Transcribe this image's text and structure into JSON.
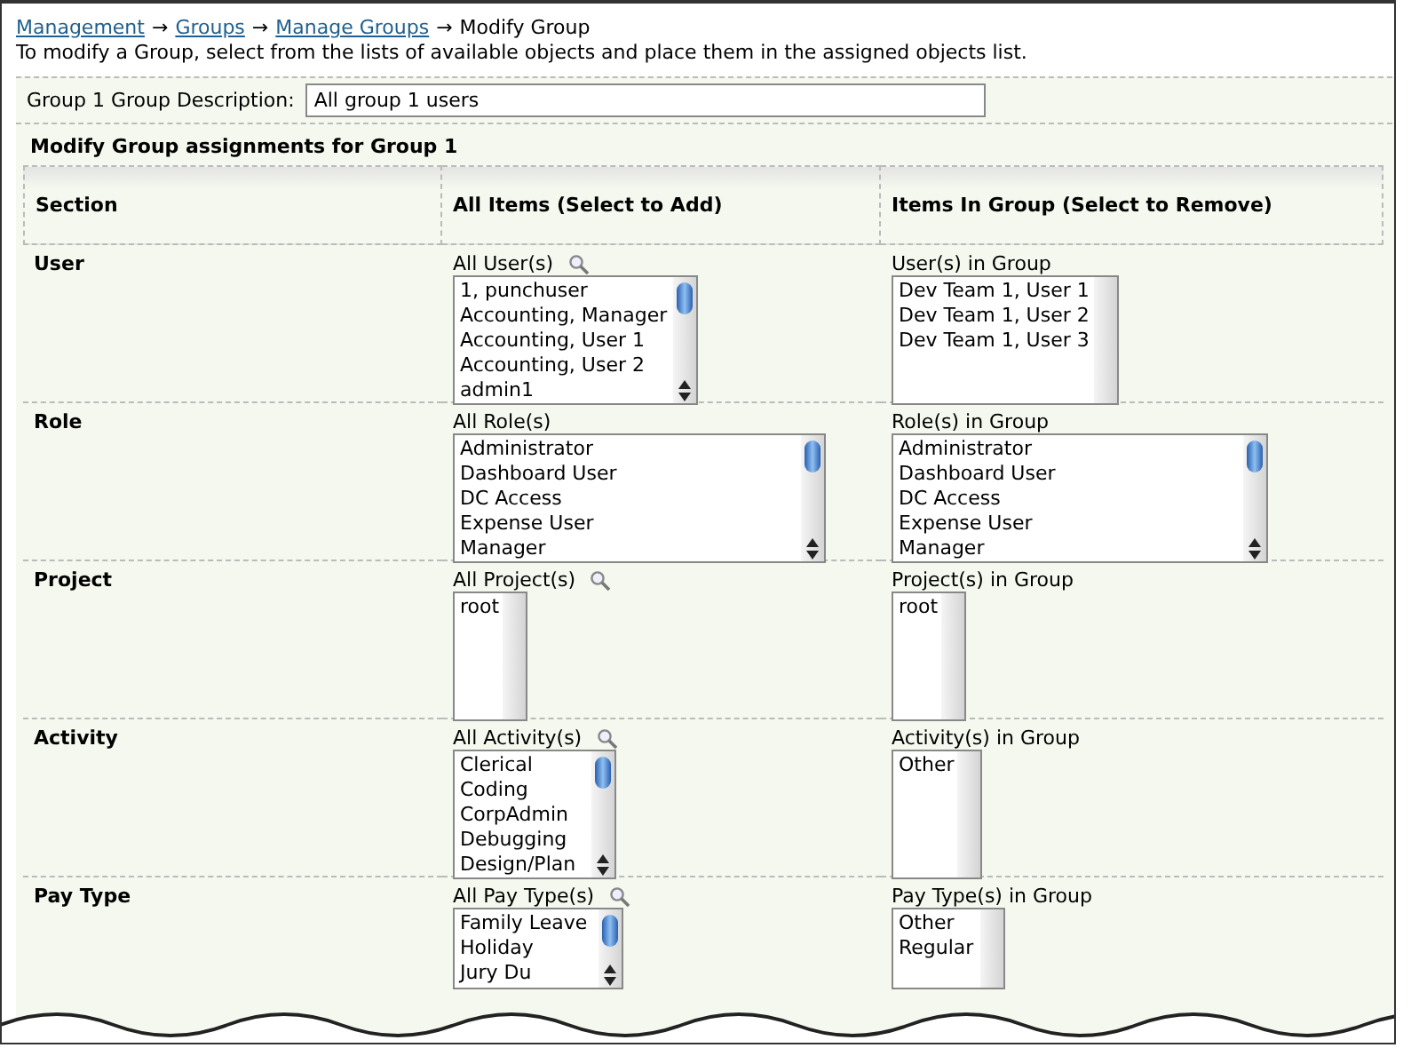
{
  "breadcrumb": [
    {
      "kind": "link",
      "label": "Management"
    },
    {
      "kind": "separator",
      "label": "→"
    },
    {
      "kind": "link",
      "label": "Groups"
    },
    {
      "kind": "separator",
      "label": "→"
    },
    {
      "kind": "link",
      "label": "Manage Groups"
    },
    {
      "kind": "separator",
      "label": "→"
    },
    {
      "kind": "current",
      "label": "Modify Group"
    }
  ],
  "instructions": "To modify a Group, select from the lists of available objects and place them in the assigned objects list.",
  "description": {
    "label": "Group 1 Group Description:",
    "value": "All group 1 users"
  },
  "assignments_title": "Modify Group assignments for Group 1",
  "columns": [
    "Section",
    "All Items (Select to Add)",
    "Items In Group (Select to Remove)"
  ],
  "rows": [
    {
      "section": "User",
      "available": {
        "label": "All User(s)",
        "search": true,
        "kind": "scrolling",
        "items": [
          "1, punchuser",
          "Accounting, Manager",
          "Accounting, User 1",
          "Accounting, User 2",
          "admin1"
        ]
      },
      "assigned": {
        "label": "User(s) in Group",
        "kind": "static",
        "items": [
          "Dev Team 1, User 1",
          "Dev Team 1, User 2",
          "Dev Team 1, User 3"
        ]
      }
    },
    {
      "section": "Role",
      "available": {
        "label": "All Role(s)",
        "search": false,
        "kind": "scrolling",
        "items": [
          "Administrator",
          "Dashboard User",
          "DC Access",
          "Expense User",
          "Manager"
        ]
      },
      "assigned": {
        "label": "Role(s) in Group",
        "kind": "scrolling",
        "items": [
          "Administrator",
          "Dashboard User",
          "DC Access",
          "Expense User",
          "Manager"
        ]
      }
    },
    {
      "section": "Project",
      "available": {
        "label": "All Project(s)",
        "search": true,
        "kind": "static",
        "items": [
          "root"
        ]
      },
      "assigned": {
        "label": "Project(s) in Group",
        "kind": "static",
        "items": [
          "root"
        ]
      }
    },
    {
      "section": "Activity",
      "available": {
        "label": "All Activity(s)",
        "search": true,
        "kind": "scrolling",
        "items": [
          "Clerical",
          "Coding",
          "CorpAdmin",
          "Debugging",
          "Design/Plan"
        ]
      },
      "assigned": {
        "label": "Activity(s) in Group",
        "kind": "static",
        "items": [
          "Other"
        ]
      }
    },
    {
      "section": "Pay Type",
      "available": {
        "label": "All Pay Type(s)",
        "search": true,
        "kind": "scrolling",
        "items": [
          "Family Leave",
          "Holiday",
          "Jury Du"
        ]
      },
      "assigned": {
        "label": "Pay Type(s) in Group",
        "kind": "static",
        "items": [
          "Other",
          "Regular"
        ]
      }
    }
  ]
}
